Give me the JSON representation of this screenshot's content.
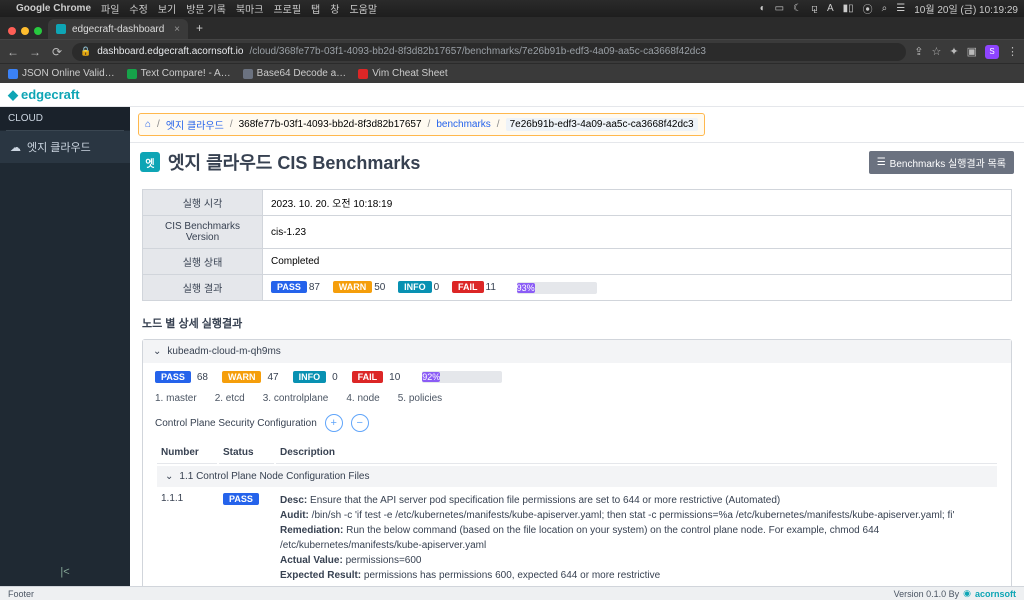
{
  "menubar": {
    "app": "Google Chrome",
    "items": [
      "파일",
      "수정",
      "보기",
      "방문 기록",
      "북마크",
      "프로필",
      "탭",
      "창",
      "도움말"
    ],
    "clock": "10월 20일 (금) 10:19:29"
  },
  "chrome": {
    "tab_title": "edgecraft-dashboard",
    "url_host": "dashboard.edgecraft.acornsoft.io",
    "url_path": "/cloud/368fe77b-03f1-4093-bb2d-8f3d82b17657/benchmarks/7e26b91b-edf3-4a09-aa5c-ca3668f42dc3",
    "bookmarks": [
      "JSON Online Valid…",
      "Text Compare! - A…",
      "Base64 Decode a…",
      "Vim Cheat Sheet"
    ]
  },
  "logo": "edgecraft",
  "sidebar": {
    "head": "CLOUD",
    "item": "엣지 클라우드"
  },
  "breadcrumb": {
    "home": "⌂",
    "cloud": "엣지 클라우드",
    "id1": "368fe77b-03f1-4093-bb2d-8f3d82b17657",
    "bench": "benchmarks",
    "id2": "7e26b91b-edf3-4a09-aa5c-ca3668f42dc3"
  },
  "page": {
    "badge": "엣",
    "title": "엣지 클라우드 CIS Benchmarks",
    "list_btn": "Benchmarks 실행결과 목록"
  },
  "summary": {
    "rows": {
      "time_label": "실행 시각",
      "time_val": "2023. 10. 20. 오전 10:18:19",
      "ver_label": "CIS Benchmarks Version",
      "ver_val": "cis-1.23",
      "state_label": "실행 상태",
      "state_val": "Completed",
      "result_label": "실행 결과"
    },
    "counts": {
      "pass": "87",
      "warn": "50",
      "info": "0",
      "fail": "11"
    },
    "pct": "93%"
  },
  "section_title": "노드 별 상세 실행결과",
  "node": {
    "name": "kubeadm-cloud-m-qh9ms",
    "counts": {
      "pass": "68",
      "warn": "47",
      "info": "0",
      "fail": "10"
    },
    "pct": "92%",
    "tabs": [
      "1. master",
      "2. etcd",
      "3. controlplane",
      "4. node",
      "5. policies"
    ],
    "config_title": "Control Plane Security Configuration",
    "columns": {
      "number": "Number",
      "status": "Status",
      "desc": "Description"
    },
    "subsection": "1.1 Control Plane Node Configuration Files",
    "row": {
      "num": "1.1.1",
      "status": "PASS",
      "desc_label": "Desc:",
      "desc": "Ensure that the API server pod specification file permissions are set to 644 or more restrictive (Automated)",
      "audit_label": "Audit:",
      "audit": "/bin/sh -c 'if test -e /etc/kubernetes/manifests/kube-apiserver.yaml; then stat -c permissions=%a /etc/kubernetes/manifests/kube-apiserver.yaml; fi'",
      "rem_label": "Remediation:",
      "rem": "Run the below command (based on the file location on your system) on the control plane node. For example, chmod 644 /etc/kubernetes/manifests/kube-apiserver.yaml",
      "av_label": "Actual Value:",
      "av": "permissions=600",
      "er_label": "Expected Result:",
      "er": "permissions has permissions 600, expected 644 or more restrictive"
    }
  },
  "pills": {
    "pass": "PASS",
    "warn": "WARN",
    "info": "INFO",
    "fail": "FAIL"
  },
  "footer": {
    "left": "Footer",
    "ver": "Version 0.1.0 By",
    "company": "acornsoft"
  }
}
